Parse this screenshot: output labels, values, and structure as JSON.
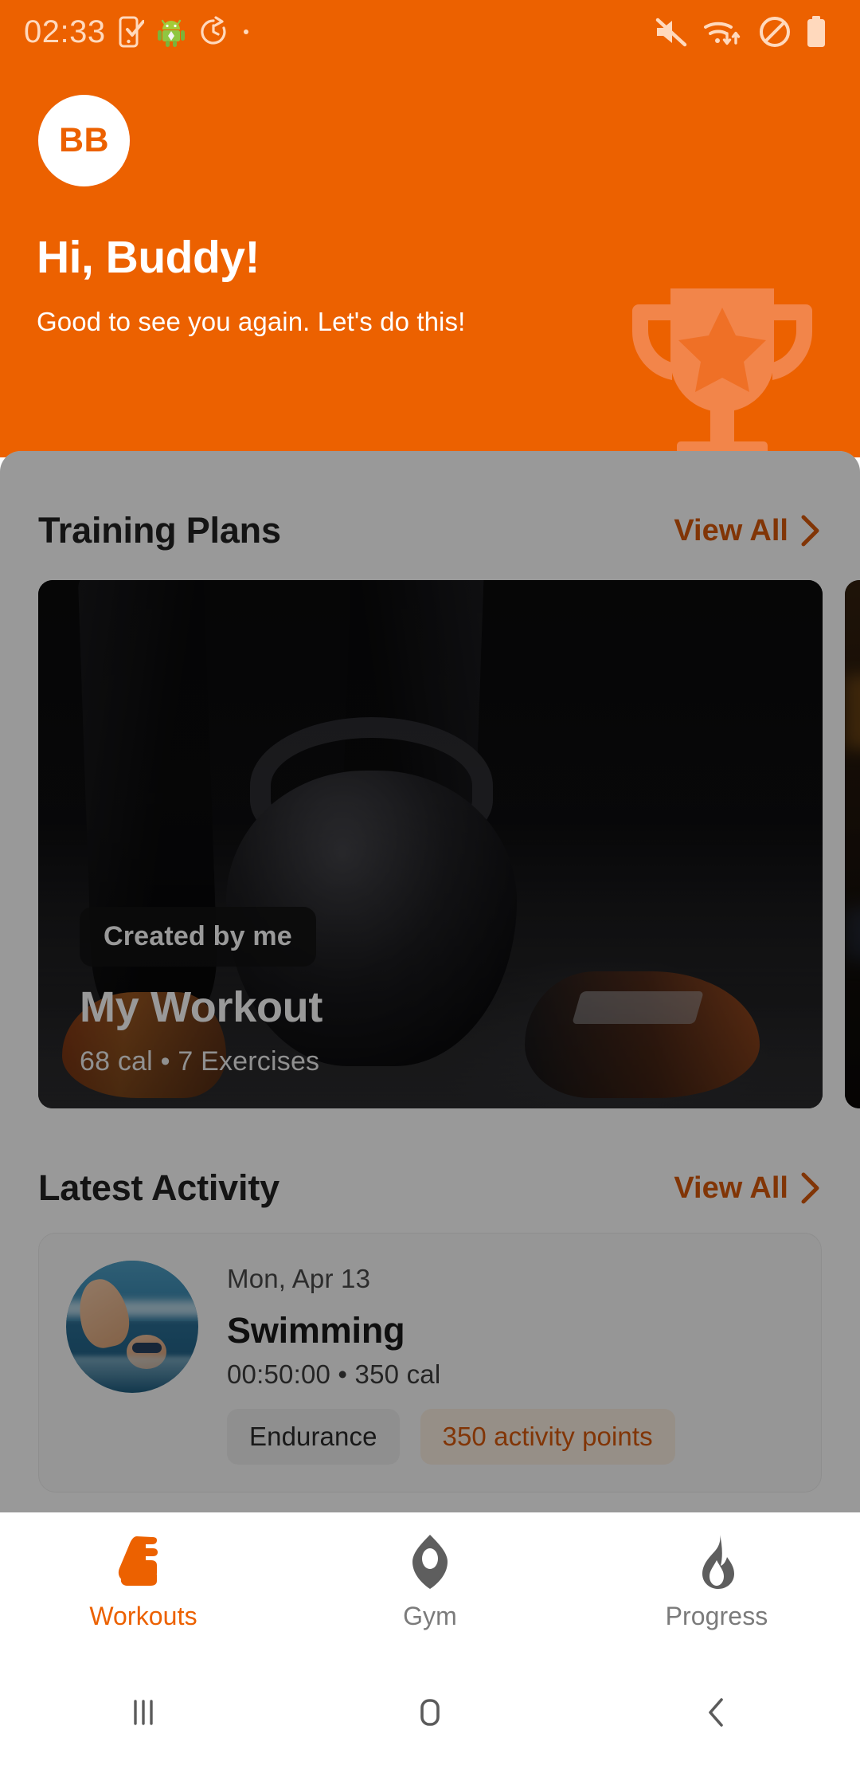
{
  "status_bar": {
    "clock": "02:33",
    "left_icons": [
      "phone-check-icon",
      "android-robot-icon",
      "history-clock-icon",
      "dot-icon"
    ],
    "right_icons": [
      "mute-icon",
      "wifi-transfer-icon",
      "do-not-disturb-icon",
      "battery-full-icon"
    ]
  },
  "header": {
    "avatar_initials": "BB",
    "greeting_title": "Hi, Buddy!",
    "greeting_subtitle": "Good to see you again. Let's do this!",
    "decoration_icon": "trophy-icon",
    "background_color": "#EC6100"
  },
  "training_plans": {
    "section_title": "Training Plans",
    "view_all_label": "View All",
    "cards": [
      {
        "badge": "Created by me",
        "title": "My Workout",
        "subtitle": "68 cal • 7 Exercises",
        "image": "kettlebell-photo"
      },
      {
        "badge": "",
        "title": "",
        "subtitle": "",
        "image": "gym-photo"
      }
    ]
  },
  "latest_activity": {
    "section_title": "Latest Activity",
    "view_all_label": "View All",
    "items": [
      {
        "thumbnail": "swimming-photo",
        "date": "Mon, Apr 13",
        "name": "Swimming",
        "stats": "00:50:00 • 350 cal",
        "tag_chip": "Endurance",
        "points_chip": "350 activity points"
      }
    ]
  },
  "bottom_nav": {
    "items": [
      {
        "label": "Workouts",
        "icon": "shoe-icon",
        "active": true
      },
      {
        "label": "Gym",
        "icon": "gym-location-icon",
        "active": false
      },
      {
        "label": "Progress",
        "icon": "flame-icon",
        "active": false
      }
    ],
    "active_color": "#EC6100",
    "inactive_color": "#7b7b7b"
  },
  "system_nav": {
    "recents": "recents-icon",
    "home": "home-icon",
    "back": "back-icon"
  },
  "theme": {
    "accent": "#EC6100",
    "link": "#D8590B",
    "scrim": "rgba(0,0,0,0.40)"
  }
}
